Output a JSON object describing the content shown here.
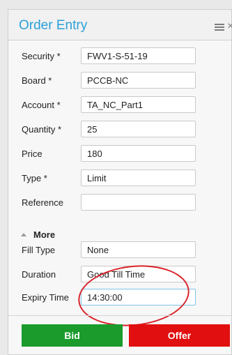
{
  "window": {
    "title": "Order Entry"
  },
  "form": {
    "security": {
      "label": "Security *",
      "value": "FWV1-S-51-19"
    },
    "board": {
      "label": "Board *",
      "value": "PCCB-NC"
    },
    "account": {
      "label": "Account *",
      "value": "TA_NC_Part1"
    },
    "quantity": {
      "label": "Quantity *",
      "value": "25"
    },
    "price": {
      "label": "Price",
      "value": "180"
    },
    "type": {
      "label": "Type *",
      "value": "Limit"
    },
    "reference": {
      "label": "Reference",
      "value": ""
    }
  },
  "more": {
    "label": "More"
  },
  "advanced": {
    "fill_type": {
      "label": "Fill Type",
      "value": "None"
    },
    "duration": {
      "label": "Duration",
      "value": "Good Till Time"
    },
    "expiry_time": {
      "label": "Expiry Time",
      "value": "14:30:00"
    }
  },
  "buttons": {
    "bid": "Bid",
    "offer": "Offer"
  },
  "colors": {
    "accent": "#2aa0d8",
    "bid": "#1a9b2c",
    "offer": "#e10f0f",
    "annotation": "#d9232b"
  }
}
